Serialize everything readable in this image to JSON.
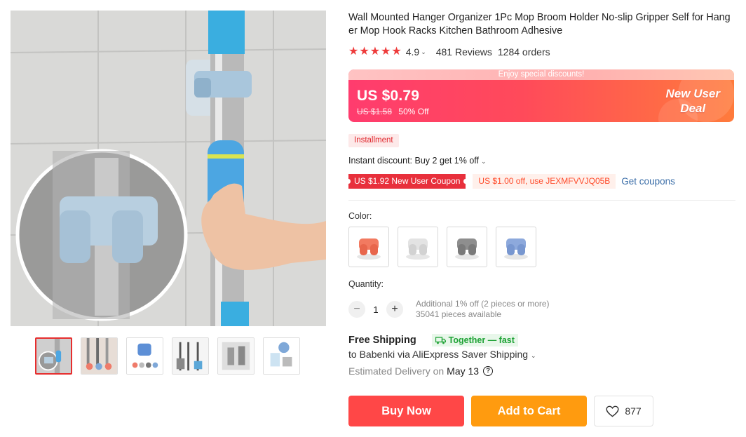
{
  "product": {
    "title": "Wall Mounted Hanger Organizer 1Pc Mop Broom Holder No-slip Gripper Self for Hanger Mop Hook Racks Kitchen Bathroom Adhesive",
    "rating": "4.9",
    "reviews": "481 Reviews",
    "orders": "1284 orders"
  },
  "gallery": {
    "main_image_icon": "mop-holder-photo",
    "thumbnails": [
      "thumb-1",
      "thumb-2",
      "thumb-3",
      "thumb-4",
      "thumb-5",
      "thumb-6"
    ],
    "active_index": 0
  },
  "price": {
    "banner_text": "Enjoy special discounts!",
    "current": "US $0.79",
    "original": "US $1.58",
    "discount": "50% Off",
    "deal_line1": "New User",
    "deal_line2": "Deal"
  },
  "installment": "Installment",
  "instant_discount": "Instant discount: Buy 2 get 1% off",
  "coupons": {
    "new_user": "US $1.92 New User Coupon",
    "code": "US $1.00 off, use JEXMFVVJQ05B",
    "get": "Get coupons"
  },
  "color": {
    "label": "Color:",
    "options": [
      "orange",
      "white",
      "gray",
      "blue"
    ]
  },
  "quantity": {
    "label": "Quantity:",
    "value": "1",
    "minus": "−",
    "plus": "+",
    "additional": "Additional 1% off (2 pieces or more)",
    "available": "35041 pieces available"
  },
  "shipping": {
    "title": "Free Shipping",
    "badge": "Together — fast",
    "to": "to Babenki via AliExpress Saver Shipping",
    "estimated_label": "Estimated Delivery on",
    "date": "May 13",
    "help": "?"
  },
  "actions": {
    "buy": "Buy Now",
    "cart": "Add to Cart",
    "wishlist_count": "877"
  },
  "colors": {
    "accent_red": "#ff4747",
    "accent_orange": "#ff9b0f",
    "star": "#ee3b3b",
    "green_badge": "#1fa336",
    "link_blue": "#3b6ea8"
  }
}
